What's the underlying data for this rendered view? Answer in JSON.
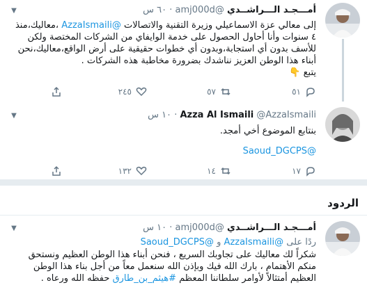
{
  "tweet1": {
    "name": "أمـــجـد الـــراشــدي",
    "handle": "@amj000d",
    "time": "٦٠ س",
    "mention": "@AzzaIsmaili",
    "text_before": "إلى معالي عزة الاسماعيلي وزيرة التقنية والاتصالات ",
    "text_after": " ،معاليك،منذ ٤ سنوات وأنا أحاول الحصول على خدمة الوايفاي من الشركات المختصة ولكن للأسف بدون أي استجابة،وبدون أي خطوات حقيقية على أرض الواقع،معاليك،نحن أبناء هذا الوطن العزيز نناشدك بضرورة مخاطبة هذه الشركات .",
    "follow": "يتبع",
    "emoji": "👇",
    "replies": "٥١",
    "retweets": "٥٧",
    "likes": "٢٤٥"
  },
  "tweet2": {
    "name": "Azza Al Ismaili",
    "handle": "@AzzaIsmaili",
    "time": "١٠ س",
    "text": "بنتابع الموضوع أخي أمجد.",
    "mention": "@Saoud_DGCPS",
    "replies": "١٧",
    "retweets": "١٤",
    "likes": "١٣٢"
  },
  "section": {
    "title": "الردود"
  },
  "tweet3": {
    "name": "أمـــجـد الـــراشــدي",
    "handle": "@amj000d",
    "time": "١٠ س",
    "reply_prefix": "ردًا على",
    "reply_mention1": "@AzzaIsmaili",
    "reply_and": "و",
    "reply_mention2": "@Saoud_DGCPS",
    "text": "شكراً لك معاليك على تجاوبك السريع ، فنحن أبناء هذا الوطن العظيم ونستحق منكم الأهتمام ، بارك الله فيك وبإذن الله سنعمل معاً من أجل بناء هذا الوطن العظيم أمتثالاً لأوامر سلطاننا المعظم",
    "hashtag": "#هيثم_بن_طارق",
    "text_end": "حفظه الله ورعاه ."
  },
  "icons": {
    "reply": "reply-icon",
    "retweet": "retweet-icon",
    "like": "heart-icon",
    "share": "share-icon",
    "caret": "chevron-down-icon"
  },
  "colors": {
    "link": "#1b95e0",
    "muted": "#657786",
    "divider": "#e6ecf0",
    "thread_line": "#ccd6dd"
  }
}
